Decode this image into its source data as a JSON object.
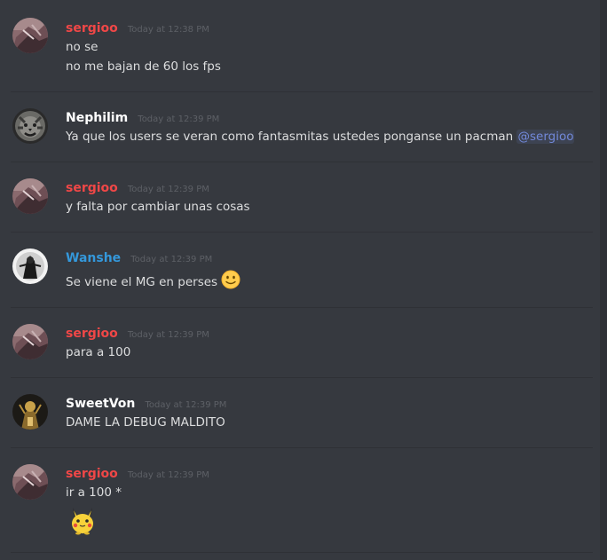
{
  "colors": {
    "background": "#36393f",
    "sergioo": "#f04747",
    "nephilim": "#ffffff",
    "wanshe": "#3498db",
    "sweetvon": "#ffffff",
    "mention": "#7289da"
  },
  "messages": [
    {
      "username": "sergioo",
      "timestamp": "Today at 12:38 PM",
      "lines": [
        "no se",
        "no me bajan de 60 los fps"
      ]
    },
    {
      "username": "Nephilim",
      "timestamp": "Today at 12:39 PM",
      "lines": [
        "Ya que los users se veran como fantasmitas ustedes ponganse un pacman "
      ],
      "mention": "@sergioo"
    },
    {
      "username": "sergioo",
      "timestamp": "Today at 12:39 PM",
      "lines": [
        "y falta por cambiar unas cosas"
      ]
    },
    {
      "username": "Wanshe",
      "timestamp": "Today at 12:39 PM",
      "lines": [
        "Se viene el MG en perses"
      ],
      "emoji": "slightly-smiling-face-icon"
    },
    {
      "username": "sergioo",
      "timestamp": "Today at 12:39 PM",
      "lines": [
        "para a 100"
      ]
    },
    {
      "username": "SweetVon",
      "timestamp": "Today at 12:39 PM",
      "lines": [
        "DAME LA DEBUG MALDITO"
      ]
    },
    {
      "username": "sergioo",
      "timestamp": "Today at 12:39 PM",
      "lines": [
        "ir a 100 *"
      ],
      "sticker": "pikachu-emoji-icon"
    }
  ]
}
